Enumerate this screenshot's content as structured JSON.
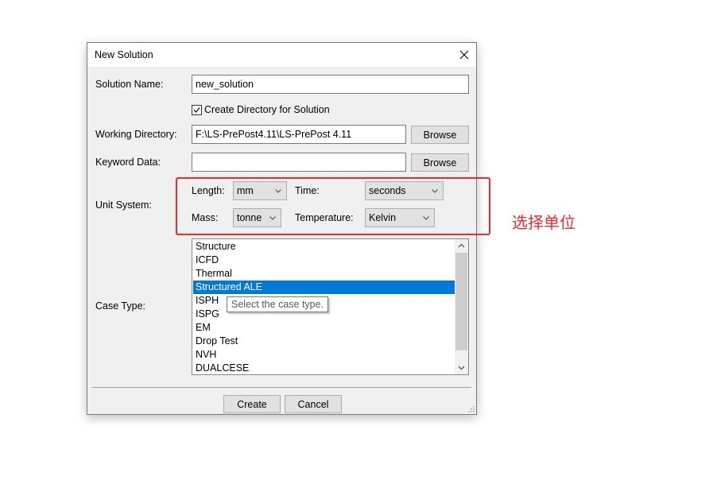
{
  "dialog": {
    "title": "New Solution",
    "solution_name": {
      "label": "Solution Name:",
      "value": "new_solution"
    },
    "create_directory": {
      "label": "Create Directory for Solution",
      "checked": true
    },
    "working_directory": {
      "label": "Working Directory:",
      "value": "F:\\LS-PrePost4.11\\LS-PrePost 4.11",
      "browse_label": "Browse"
    },
    "keyword_data": {
      "label": "Keyword Data:",
      "value": "",
      "browse_label": "Browse"
    },
    "unit_system": {
      "label": "Unit System:",
      "length": {
        "label": "Length:",
        "value": "mm"
      },
      "time": {
        "label": "Time:",
        "value": "seconds"
      },
      "mass": {
        "label": "Mass:",
        "value": "tonne"
      },
      "temperature": {
        "label": "Temperature:",
        "value": "Kelvin"
      }
    },
    "case_type": {
      "label": "Case Type:",
      "items": [
        "Structure",
        "ICFD",
        "Thermal",
        "Structured ALE",
        "ISPH",
        "ISPG",
        "EM",
        "Drop Test",
        "NVH",
        "DUALCESE"
      ],
      "selected": "Structured ALE",
      "tooltip": "Select the case type."
    },
    "buttons": {
      "create": "Create",
      "cancel": "Cancel"
    }
  },
  "annotation": {
    "text": "选择单位",
    "color": "#ee2b2b"
  },
  "colors": {
    "selection": "#0078d7",
    "annotation_red": "#ee2b2b"
  }
}
